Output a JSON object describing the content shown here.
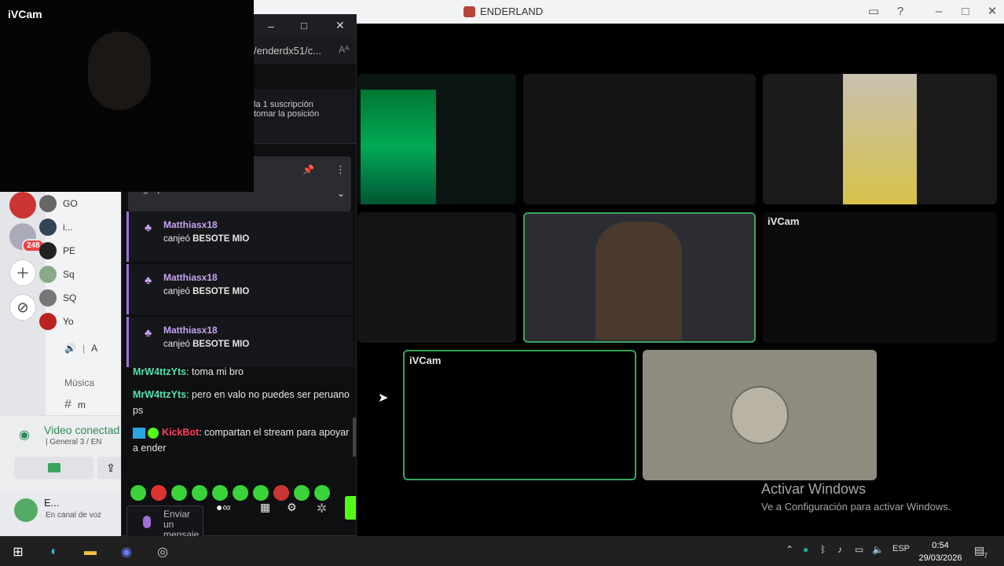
{
  "window": {
    "title": "ENDERLAND"
  },
  "ivcam": {
    "label": "iVCam"
  },
  "members": [
    {
      "name": "GO"
    },
    {
      "name": "i..."
    },
    {
      "name": "PE"
    },
    {
      "name": "Sq"
    },
    {
      "name": "SQ"
    },
    {
      "name": "Yo"
    }
  ],
  "channels": {
    "voice_channel_partial": "A",
    "category": "Música",
    "text_channel_partial": "m"
  },
  "server_badge": "248",
  "voice_panel": {
    "status": "Video conectad",
    "location": "| General 3 / EN",
    "user_name": "E...",
    "user_status": "En canal de voz"
  },
  "popout": {
    "address": "/enderdx51/c...",
    "sub_notice_line1": "la 1 suscripción",
    "sub_notice_line2": "tomar la posición",
    "pinned_partial": "...guapo"
  },
  "redeems": [
    {
      "user": "Matthiasx18",
      "action": "canjeó",
      "item": "BESOTE MIO"
    },
    {
      "user": "Matthiasx18",
      "action": "canjeó",
      "item": "BESOTE MIO"
    },
    {
      "user": "Matthiasx18",
      "action": "canjeó",
      "item": "BESOTE MIO"
    }
  ],
  "chat": [
    {
      "user": "MrW4ttzYts",
      "text": ": toma mi bro"
    },
    {
      "user": "MrW4ttzYts",
      "text": ": pero en valo no puedes ser peruano ps"
    },
    {
      "user": "KickBot",
      "text": ": compartan el stream para apoyar a ender"
    }
  ],
  "chat_input": {
    "placeholder": "Enviar un mensaje"
  },
  "video_tiles": [
    {
      "label": "iVCam"
    },
    {
      "label": "iVCam"
    },
    {
      "label": "iVCam"
    }
  ],
  "watermark": {
    "title": "Activar Windows",
    "subtitle": "Ve a Configuración para activar Windows."
  },
  "taskbar": {
    "lang": "ESP",
    "time": "0:54",
    "date": "29/03/2026",
    "notifications": "7"
  },
  "colors": {
    "accent_green": "#3ba55d",
    "kick_green": "#53fc18",
    "redeem_purple": "#c8a2f2"
  }
}
